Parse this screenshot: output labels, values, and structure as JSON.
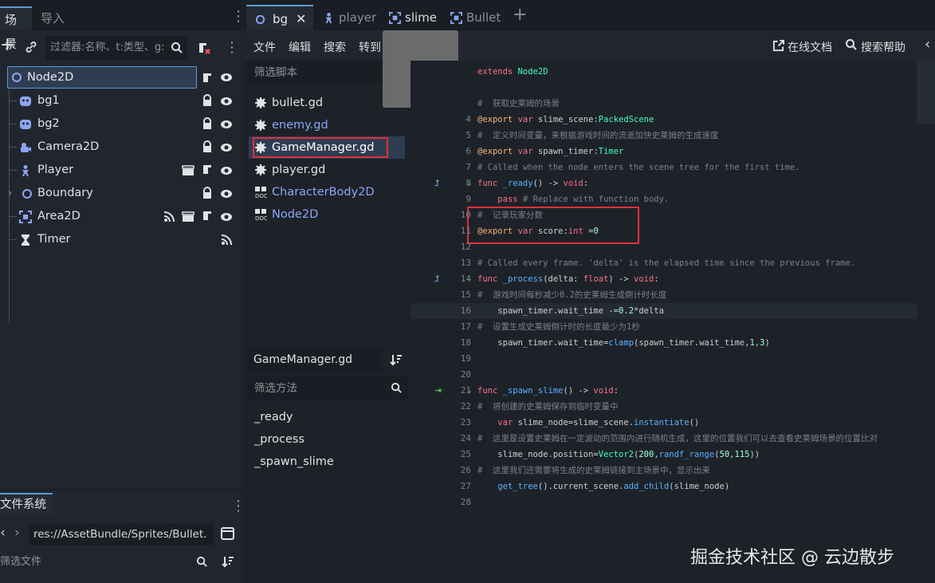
{
  "scene_dock": {
    "tab_scene": "场景",
    "tab_import": "导入",
    "filter_placeholder": "过滤器:名称、t:类型、g:",
    "tree": [
      {
        "label": "Node2D",
        "icon": "circle-node-icon"
      },
      {
        "label": "bg1",
        "icon": "sprite-icon"
      },
      {
        "label": "bg2",
        "icon": "sprite-icon"
      },
      {
        "label": "Camera2D",
        "icon": "camera-icon"
      },
      {
        "label": "Player",
        "icon": "character-icon"
      },
      {
        "label": "Boundary",
        "icon": "circle-node-icon"
      },
      {
        "label": "Area2D",
        "icon": "area-icon"
      },
      {
        "label": "Timer",
        "icon": "hourglass-icon"
      }
    ]
  },
  "fs_dock": {
    "title": "文件系统",
    "path": "res://AssetBundle/Sprites/Bullet.",
    "filter_placeholder": "筛选文件"
  },
  "editor_tabs": [
    {
      "label": "bg",
      "icon": "circle-node-icon"
    },
    {
      "label": "player",
      "icon": "character-icon"
    },
    {
      "label": "slime",
      "icon": "area-icon"
    },
    {
      "label": "Bullet",
      "icon": "area-icon"
    }
  ],
  "menu": {
    "file": "文件",
    "edit": "编辑",
    "search": "搜索",
    "goto": "转到",
    "online_docs": "在线文档",
    "search_help": "搜索帮助"
  },
  "script_list": {
    "filter_placeholder": "筛选脚本",
    "items": [
      {
        "label": "bullet.gd",
        "icon": "gear-icon"
      },
      {
        "label": "enemy.gd",
        "icon": "gear-icon"
      },
      {
        "label": "GameManager.gd",
        "icon": "gear-icon"
      },
      {
        "label": "player.gd",
        "icon": "gear-icon"
      },
      {
        "label": "CharacterBody2D",
        "icon": "doc-icon"
      },
      {
        "label": "Node2D",
        "icon": "doc-icon"
      }
    ],
    "current_script": "GameManager.gd",
    "method_filter_placeholder": "筛选方法",
    "methods": [
      "_ready",
      "_process",
      "_spawn_slime"
    ]
  },
  "code": {
    "lines": [
      {
        "n": "",
        "t": "extends Node2D"
      },
      {
        "n": "",
        "t": ""
      },
      {
        "n": "",
        "t": "#  获取史莱姆的场景"
      },
      {
        "n": "4",
        "t": "@export var slime_scene:PackedScene"
      },
      {
        "n": "5",
        "t": "#  定义时间变量，来根据游戏时间的流逝加快史莱姆的生成速度"
      },
      {
        "n": "6",
        "t": "@export var spawn_timer:Timer"
      },
      {
        "n": "7",
        "t": "# Called when the node enters the scene tree for the first time."
      },
      {
        "n": "8",
        "t": "func _ready() -> void:"
      },
      {
        "n": "9",
        "t": "    pass # Replace with function body."
      },
      {
        "n": "10",
        "t": "#  记录玩家分数"
      },
      {
        "n": "11",
        "t": "@export var score:int =0"
      },
      {
        "n": "12",
        "t": ""
      },
      {
        "n": "13",
        "t": "# Called every frame. 'delta' is the elapsed time since the previous frame."
      },
      {
        "n": "14",
        "t": "func _process(delta: float) -> void:"
      },
      {
        "n": "15",
        "t": "#  游戏时间每秒减少0.2的史莱姆生成倒计时长度"
      },
      {
        "n": "16",
        "t": "    spawn_timer.wait_time -=0.2*delta"
      },
      {
        "n": "17",
        "t": "#  设置生成史莱姆倒计时的长度最少为1秒"
      },
      {
        "n": "18",
        "t": "    spawn_timer.wait_time=clamp(spawn_timer.wait_time,1,3)"
      },
      {
        "n": "19",
        "t": ""
      },
      {
        "n": "20",
        "t": ""
      },
      {
        "n": "21",
        "t": "func _spawn_slime() -> void:"
      },
      {
        "n": "22",
        "t": "#  将创建的史莱姆保存到临时变量中"
      },
      {
        "n": "23",
        "t": "    var slime_node=slime_scene.instantiate()"
      },
      {
        "n": "24",
        "t": "#  这里是设置史莱姆在一定波动的范围内进行随机生成，这里的位置我们可以去查看史莱姆场景的位置比对"
      },
      {
        "n": "25",
        "t": "    slime_node.position=Vector2(200,randf_range(50,115))"
      },
      {
        "n": "26",
        "t": "#  这里我们还需要将生成的史莱姆链接到主场景中，显示出来"
      },
      {
        "n": "27",
        "t": "    get_tree().current_scene.add_child(slime_node)"
      },
      {
        "n": "28",
        "t": ""
      }
    ]
  },
  "watermark": "掘金技术社区 @ 云边散步",
  "colors": {
    "accent": "#5b9bd5",
    "highlight_box": "#e0303a",
    "keyword": "#ff7085",
    "function": "#57b3ff",
    "type": "#42ffc2",
    "comment": "#7c818a"
  }
}
